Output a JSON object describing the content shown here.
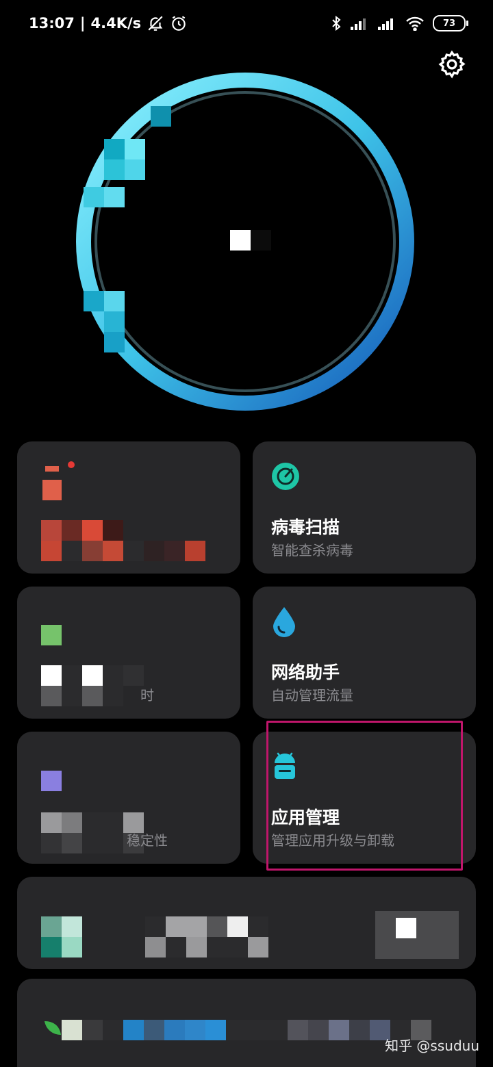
{
  "status_bar": {
    "time": "13:07",
    "network_speed": "4.4K/s",
    "battery_level": "73"
  },
  "tiles": {
    "virus_scan": {
      "title": "病毒扫描",
      "subtitle": "智能查杀病毒",
      "icon_color": "#1ec6a6"
    },
    "network_assistant": {
      "title": "网络助手",
      "subtitle": "自动管理流量",
      "icon_color": "#2aa7de"
    },
    "app_manager": {
      "title": "应用管理",
      "subtitle": "管理应用升级与卸载",
      "icon_color": "#26c6da"
    },
    "battery_tile": {
      "partial_text": "时"
    },
    "stability_tile": {
      "partial_text": "稳定性"
    }
  },
  "colors": {
    "highlight": "#c0166b",
    "tile_bg": "#272729",
    "ring_light": "#6fe7f5",
    "ring_dark": "#1565c0"
  },
  "watermark": "知乎 @ssuduu"
}
